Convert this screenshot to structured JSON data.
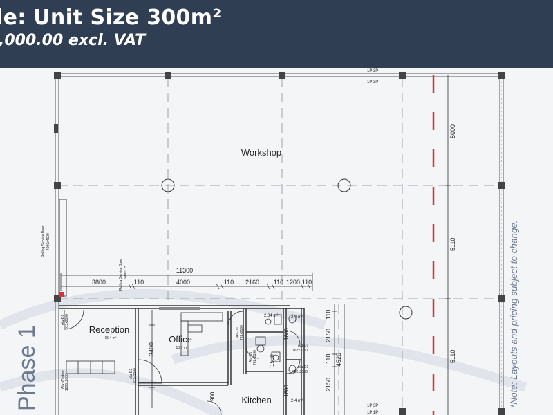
{
  "header": {
    "title": "le: Unit Size 300m²",
    "price": ",000.00 excl. VAT"
  },
  "side_labels": {
    "phase": "Phase 1",
    "note": "*Note: Layouts and pricing subject to change."
  },
  "plan": {
    "rooms": {
      "workshop": "Workshop",
      "reception": "Reception",
      "reception_area": "15.4 m²",
      "office": "Office",
      "office_area": "13.6 m²",
      "kitchen": "Kitchen",
      "wc_area_top_left": "2.34 m²",
      "wc_area_top_right": "2.4 m²",
      "wc_area_bottom": "2.4 m²"
    },
    "labels": {
      "rolling_door_left": "Rolling Service Door",
      "rolling_door_left_size": "4000x4500",
      "rolling_door_switch": "Rolling Service Door",
      "switch": "SWITCH",
      "grid_top": "1P 3P",
      "grid_top_2": "1P 3P",
      "grid_bottom": "1P 3P",
      "grid_bottom_2": "1P 1P"
    },
    "doors": {
      "d_reception": "Alu-D1",
      "d_reception_size": "813x2100",
      "d_window": "Alu-Window",
      "d_window_size": "1800x2000",
      "d_office": "Alu-D2",
      "d_office_size": "813x2100",
      "d_wc1": "Alu-D1",
      "d_wc1_size": "762x2100",
      "d_wc2": "Alu-D1",
      "d_wc2_size": "762x2100",
      "d_wc3": "Alu-D1",
      "d_wc3_size": "762x2100",
      "d_wc4": "Alu-D1",
      "d_wc4_size": "762x2100"
    },
    "dimensions": {
      "total_width": "11300",
      "seg_1": "3800",
      "seg_2": "110",
      "seg_3": "4000",
      "seg_4": "110",
      "seg_5": "2160",
      "seg_6": "110",
      "seg_7": "1200",
      "seg_8": "110",
      "right_1": "5000",
      "right_2": "5110",
      "right_3": "5110",
      "office_h": "3400",
      "wc_1600_top": "1600",
      "wc_1590": "1590",
      "wc_1600_bottom": "1600",
      "v_110_top": "110",
      "v_2150_top": "2150",
      "v_110_mid": "110",
      "v_2150_bottom": "2150",
      "v_4520": "4520",
      "kitchen_900": "900"
    }
  }
}
